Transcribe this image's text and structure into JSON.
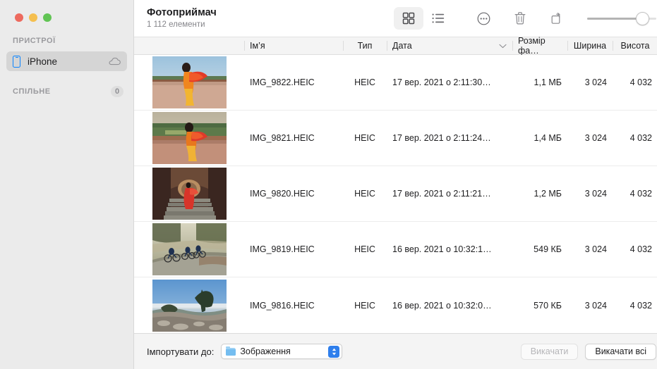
{
  "window": {
    "title": "Фотоприймач",
    "subtitle": "1 112 елементи",
    "traffic_lights": {
      "close": "close-button",
      "minimize": "minimize-button",
      "zoom": "zoom-button"
    }
  },
  "sidebar": {
    "sections": [
      {
        "label": "ПРИСТРОЇ",
        "badge": ""
      },
      {
        "label": "СПІЛЬНЕ",
        "badge": "0"
      }
    ],
    "devices": [
      {
        "label": "iPhone",
        "icon": "iphone-icon",
        "trailing_icon": "cloud-icon",
        "selected": true
      }
    ]
  },
  "toolbar": {
    "items": [
      {
        "name": "grid-view-button",
        "icon": "grid-icon",
        "active": true
      },
      {
        "name": "list-view-button",
        "icon": "list-icon",
        "active": false
      },
      {
        "name": "more-options-button",
        "icon": "ellipsis-circle-icon",
        "active": false
      },
      {
        "name": "delete-button",
        "icon": "trash-icon",
        "active": false
      },
      {
        "name": "rotate-button",
        "icon": "rotate-icon",
        "active": false
      }
    ],
    "slider": {
      "name": "thumbnail-size-slider",
      "value": 70
    }
  },
  "table": {
    "columns": [
      {
        "key": "name",
        "label": "Ім’я"
      },
      {
        "key": "type",
        "label": "Тип"
      },
      {
        "key": "date",
        "label": "Дата",
        "sorted": true,
        "sort_icon": "chevron-down-icon"
      },
      {
        "key": "size",
        "label": "Розмір фа…"
      },
      {
        "key": "width",
        "label": "Ширина"
      },
      {
        "key": "height",
        "label": "Висота"
      }
    ],
    "rows": [
      {
        "name": "IMG_9822.HEIC",
        "type": "HEIC",
        "date": "17 вер. 2021 о 2:11:30…",
        "size": "1,1 МБ",
        "width": "3 024",
        "height": "4 032",
        "thumb": "woman-red-sari-terrace"
      },
      {
        "name": "IMG_9821.HEIC",
        "type": "HEIC",
        "date": "17 вер. 2021 о 2:11:24…",
        "size": "1,4 МБ",
        "width": "3 024",
        "height": "4 032",
        "thumb": "woman-red-sari-garden"
      },
      {
        "name": "IMG_9820.HEIC",
        "type": "HEIC",
        "date": "17 вер. 2021 о 2:11:21…",
        "size": "1,2 МБ",
        "width": "3 024",
        "height": "4 032",
        "thumb": "woman-red-sari-stairs"
      },
      {
        "name": "IMG_9819.HEIC",
        "type": "HEIC",
        "date": "16 вер. 2021 о 10:32:1…",
        "size": "549 КБ",
        "width": "3 024",
        "height": "4 032",
        "thumb": "cyclists-misty-road"
      },
      {
        "name": "IMG_9816.HEIC",
        "type": "HEIC",
        "date": "16 вер. 2021 о 10:32:0…",
        "size": "570 КБ",
        "width": "3 024",
        "height": "4 032",
        "thumb": "tree-above-clouds"
      }
    ]
  },
  "bottom_bar": {
    "import_label": "Імпортувати до:",
    "destination": {
      "value": "Зображення",
      "icon": "folder-icon"
    },
    "download_button": {
      "label": "Викачати",
      "disabled": true
    },
    "download_all_button": {
      "label": "Викачати всі",
      "disabled": false
    }
  },
  "colors": {
    "accent": "#2f7fec",
    "device_icon": "#0a84ff",
    "sidebar_bg": "#ebebeb",
    "selection_bg": "#d5d5d5"
  }
}
